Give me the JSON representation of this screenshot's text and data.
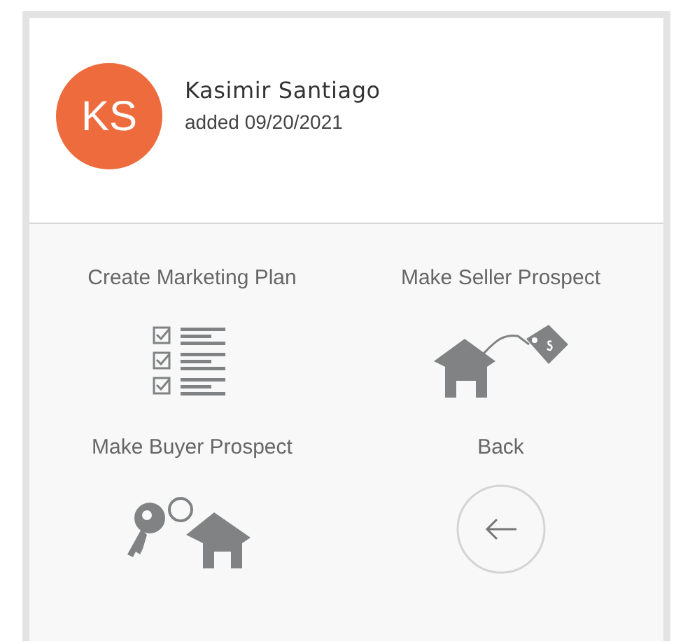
{
  "contact": {
    "initials": "KS",
    "color": "#ee6b3e",
    "name": "Kasimir Santiago",
    "added": "added 09/20/2021"
  },
  "actions": [
    {
      "label": "Create Marketing Plan",
      "kind": "checklist"
    },
    {
      "label": "Make Seller Prospect",
      "kind": "house-tag"
    },
    {
      "label": "Make Buyer Prospect",
      "kind": "key-house"
    },
    {
      "label": "Back",
      "kind": "back"
    }
  ]
}
